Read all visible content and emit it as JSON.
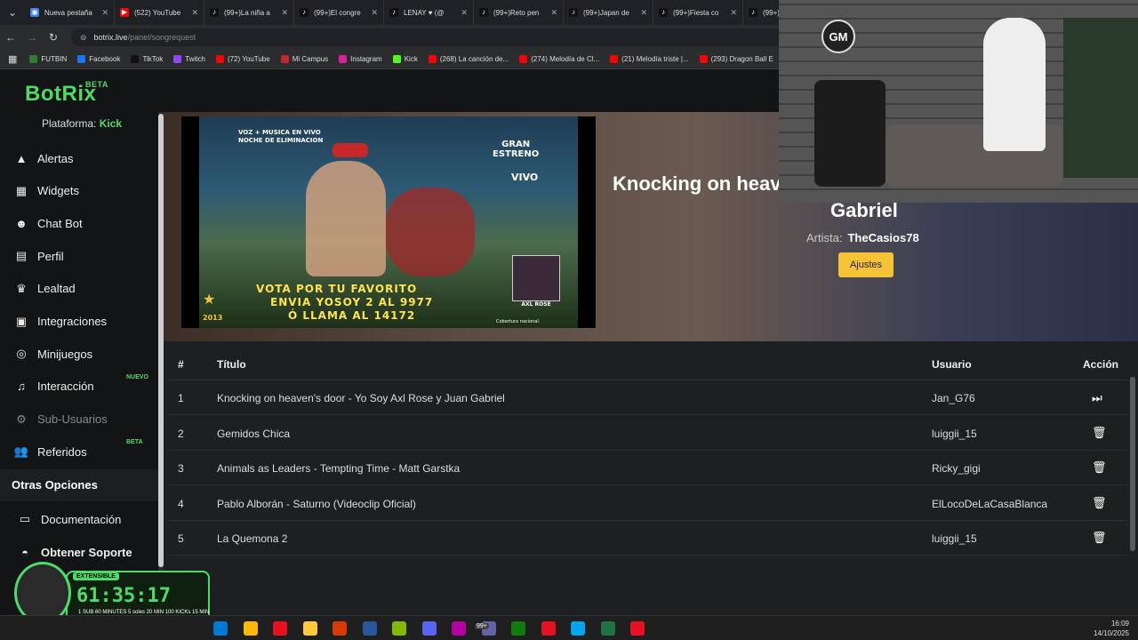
{
  "browser": {
    "tabs": [
      {
        "title": "Nueva pestaña",
        "icon": "chrome-icon"
      },
      {
        "title": "(522) YouTube",
        "icon": "youtube-icon"
      },
      {
        "title": "(99+)La niña a",
        "icon": "tiktok-icon"
      },
      {
        "title": "(99+)El congre",
        "icon": "tiktok-icon"
      },
      {
        "title": "LENAY ♥ (@",
        "icon": "tiktok-icon"
      },
      {
        "title": "(99+)Reto pen",
        "icon": "tiktok-icon"
      },
      {
        "title": "(99+)Japan de",
        "icon": "tiktok-icon"
      },
      {
        "title": "(99+)Fiesta co",
        "icon": "tiktok-icon"
      },
      {
        "title": "(99+)(",
        "icon": "tiktok-icon"
      }
    ],
    "url_host": "botrix.live",
    "url_path": "/panel/songrequest",
    "bookmarks": [
      {
        "label": "FUTBIN",
        "color": "#2e7d32"
      },
      {
        "label": "Facebook",
        "color": "#1877f2"
      },
      {
        "label": "TikTok",
        "color": "#111111"
      },
      {
        "label": "Twitch",
        "color": "#9146ff"
      },
      {
        "label": "(72) YouTube",
        "color": "#ff0000"
      },
      {
        "label": "Mi Campus",
        "color": "#c62828"
      },
      {
        "label": "Instagram",
        "color": "#d6249f"
      },
      {
        "label": "Kick",
        "color": "#53fc18"
      },
      {
        "label": "(268) La canción de...",
        "color": "#ff0000"
      },
      {
        "label": "(274) Melodía de Cl...",
        "color": "#ff0000"
      },
      {
        "label": "(21) Melodía triste |...",
        "color": "#ff0000"
      },
      {
        "label": "(293) Dragon Ball E",
        "color": "#ff0000"
      }
    ]
  },
  "app": {
    "brand": "BotRix",
    "brand_badge": "BETA",
    "platform_label": "Plataforma:",
    "platform_value": "Kick",
    "menu": [
      {
        "label": "Alertas",
        "icon": "warning-icon"
      },
      {
        "label": "Widgets",
        "icon": "widgets-icon"
      },
      {
        "label": "Chat Bot",
        "icon": "robot-icon"
      },
      {
        "label": "Perfil",
        "icon": "profile-card-icon"
      },
      {
        "label": "Lealtad",
        "icon": "trophy-icon"
      },
      {
        "label": "Integraciones",
        "icon": "integrations-icon"
      },
      {
        "label": "Minijuegos",
        "icon": "gamepad-icon"
      },
      {
        "label": "Interacción",
        "icon": "music-note-icon",
        "tag": "NUEVO"
      },
      {
        "label": "Sub-Usuarios",
        "icon": "gear-icon"
      },
      {
        "label": "Referidos",
        "icon": "users-icon",
        "tag": "BETA"
      }
    ],
    "other_options_title": "Otras Opciones",
    "other_menu": [
      {
        "label": "Documentación",
        "icon": "book-icon"
      },
      {
        "label": "Obtener Soporte",
        "icon": "discord-icon"
      }
    ]
  },
  "player": {
    "title_part1": "Knocking on heav",
    "title_part2": "Gabriel",
    "artist_label": "Artista:",
    "artist_value": "TheCasios78",
    "settings_button": "Ajustes",
    "video_text": {
      "corner": "VOZ + MUSICA EN VIVO\nNOCHE DE ELIMINACION",
      "badge": "GRAN\nESTRENO",
      "live": "VIVO",
      "vote_line1": "VOTA POR TU FAVORITO",
      "vote_line2": "ENVIA YOSOY  2 AL 9977",
      "vote_line3": "Ó LLAMA AL 14172",
      "year": "2013",
      "name_tag": "AXL ROSE",
      "credit": "Cobertura nacional."
    }
  },
  "queue": {
    "headers": {
      "num": "#",
      "title": "Título",
      "user": "Usuario",
      "action": "Acción"
    },
    "rows": [
      {
        "num": "1",
        "title": "Knocking on heaven's door - Yo Soy Axl Rose y Juan Gabriel",
        "user": "Jan_G76",
        "action": "skip"
      },
      {
        "num": "2",
        "title": "Gemidos Chica",
        "user": "luiggii_15",
        "action": "delete"
      },
      {
        "num": "3",
        "title": "Animals as Leaders - Tempting Time - Matt Garstka",
        "user": "Ricky_gigi",
        "action": "delete"
      },
      {
        "num": "4",
        "title": "Pablo Alborán - Saturno (Videoclip Oficial)",
        "user": "ElLocoDeLaCasaBlanca",
        "action": "delete"
      },
      {
        "num": "5",
        "title": "La Quemona 2",
        "user": "luiggii_15",
        "action": "delete"
      }
    ]
  },
  "overlay": {
    "cam_logo": "GM",
    "timer_badge": "EXTENSIBLE",
    "timer": "61:35:17",
    "timer_info": "1 SUB 60 MINUTES   5 soles 20 MIN   100 KICKs 15 MIN"
  },
  "taskbar": {
    "time": "16:09",
    "date": "14/10/2025",
    "badge": "99+"
  }
}
